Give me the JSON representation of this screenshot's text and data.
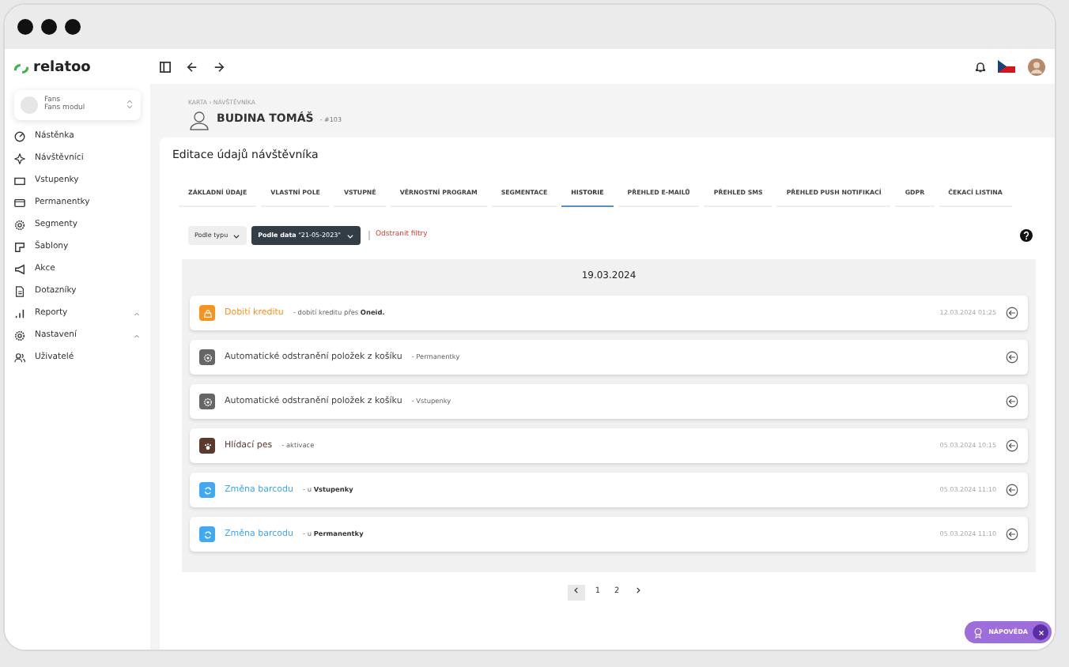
{
  "sidebar": {
    "logo": "relatoo",
    "org": {
      "name": "Fans",
      "module": "Fans modul"
    },
    "items": [
      {
        "label": "Nástěnka",
        "kind": "link"
      },
      {
        "label": "Návštěvníci",
        "kind": "link"
      },
      {
        "label": "Vstupenky",
        "kind": "link"
      },
      {
        "label": "Permanentky",
        "kind": "link"
      },
      {
        "label": "Segmenty",
        "kind": "link"
      },
      {
        "label": "Šablony",
        "kind": "link"
      },
      {
        "label": "Akce",
        "kind": "link"
      },
      {
        "label": "Dotazníky",
        "kind": "link"
      },
      {
        "label": "Reporty",
        "kind": "group"
      },
      {
        "label": "Nastavení",
        "kind": "group"
      },
      {
        "label": "Uživatelé",
        "kind": "link"
      }
    ]
  },
  "breadcrumb": "KARTA › NÁVŠTĚVNÍKA",
  "visitor": {
    "name": "BUDINA TOMÁŠ",
    "id": "- #103"
  },
  "card_title": "Editace údajů návštěvníka",
  "tabs": [
    {
      "label": "ZÁKLADNÍ ÚDAJE",
      "selected": false
    },
    {
      "label": "VLASTNÍ POLE",
      "selected": false
    },
    {
      "label": "VSTUPNÉ",
      "selected": false
    },
    {
      "label": "VĚRNOSTNÍ PROGRAM",
      "selected": false
    },
    {
      "label": "SEGMENTACE",
      "selected": false
    },
    {
      "label": "HISTORIE",
      "selected": true
    },
    {
      "label": "PŘEHLED E-MAILŮ",
      "selected": false
    },
    {
      "label": "PŘEHLED SMS",
      "selected": false
    },
    {
      "label": "PŘEHLED PUSH NOTIFIKACÍ",
      "selected": false
    },
    {
      "label": "GDPR",
      "selected": false
    },
    {
      "label": "ČEKACÍ LISTINA",
      "selected": false
    }
  ],
  "filters": [
    {
      "label": "Podle typu",
      "active": false
    },
    {
      "label": "**Podle data** \"21-05-2023\"",
      "active": true
    }
  ],
  "remove_filters": "Odstranit filtry",
  "date_header": "19.03.2024",
  "events": [
    {
      "kind": "credit",
      "title": "Dobití kreditu",
      "detail": "- dobití kreditu přes **Oneid.**",
      "time": "12.03.2024 01:25",
      "color": "#f7941d"
    },
    {
      "kind": "automatic",
      "title": "Automatické odstranění položek z košíku",
      "detail": "- Permanentky",
      "color": "#666666"
    },
    {
      "kind": "automatic",
      "title": "Automatické odstranění položek z košíku",
      "detail": "- Vstupenky",
      "color": "#666666"
    },
    {
      "kind": "watchdog",
      "title": "Hlídací pes",
      "detail": "- aktivace",
      "time": "05.03.2024 10:15",
      "color": "#5b3a2e"
    },
    {
      "kind": "barcode",
      "title": "Změna barcodu",
      "detail": "- u **Vstupenky**",
      "time": "05.03.2024 11:10",
      "color": "#3fa9f5"
    },
    {
      "kind": "barcode",
      "title": "Změna barcodu",
      "detail": "- u **Permanentky**",
      "time": "05.03.2024 11:10",
      "color": "#3fa9f5"
    }
  ],
  "pagination": {
    "pages": [
      {
        "label": "1",
        "selected": false
      },
      {
        "label": "2",
        "selected": false
      }
    ],
    "prev_disabled": true
  },
  "help_button": "NÁPOVĚDA"
}
